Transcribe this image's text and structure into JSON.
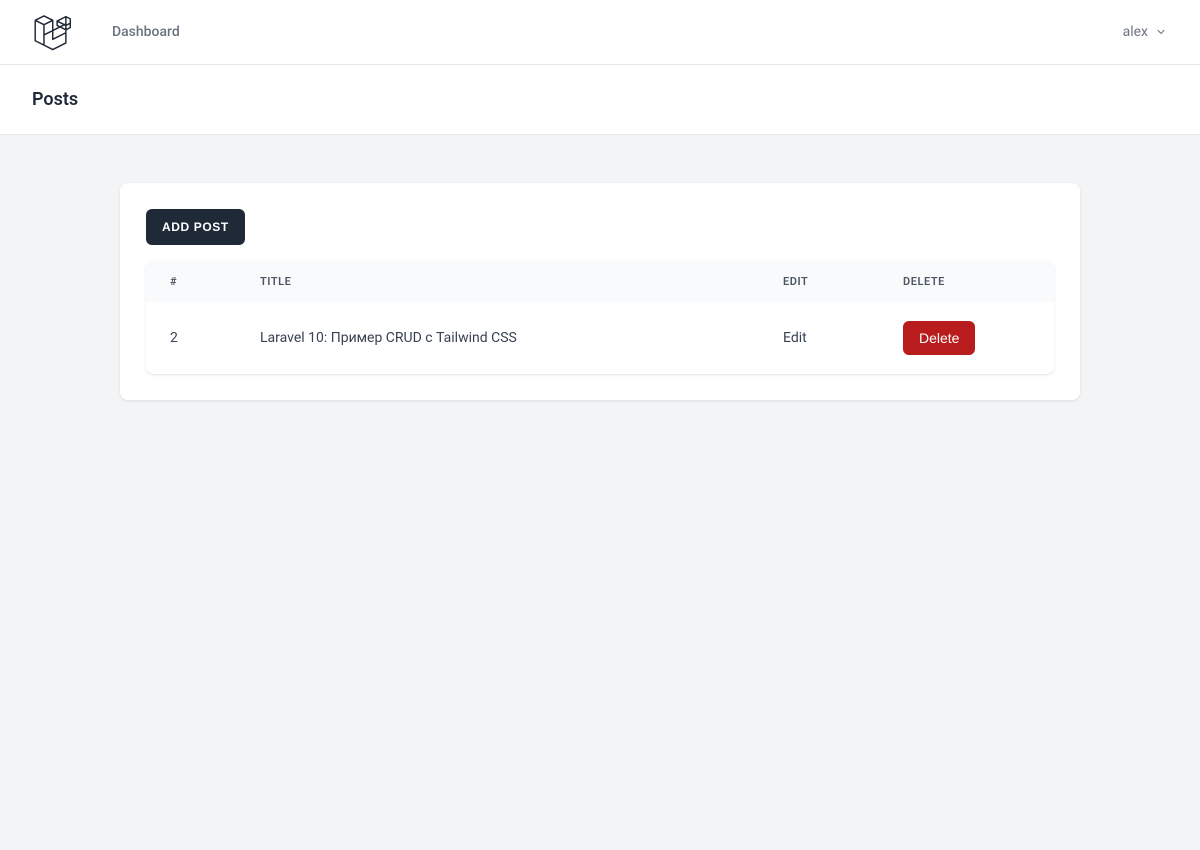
{
  "nav": {
    "dashboard_label": "Dashboard",
    "username": "alex"
  },
  "header": {
    "title": "Posts"
  },
  "actions": {
    "add_post": "ADD POST"
  },
  "table": {
    "headers": {
      "id": "#",
      "title": "TITLE",
      "edit": "EDIT",
      "delete": "DELETE"
    },
    "rows": [
      {
        "id": "2",
        "title": "Laravel 10: Пример CRUD с Tailwind CSS",
        "edit_label": "Edit",
        "delete_label": "Delete"
      }
    ]
  }
}
